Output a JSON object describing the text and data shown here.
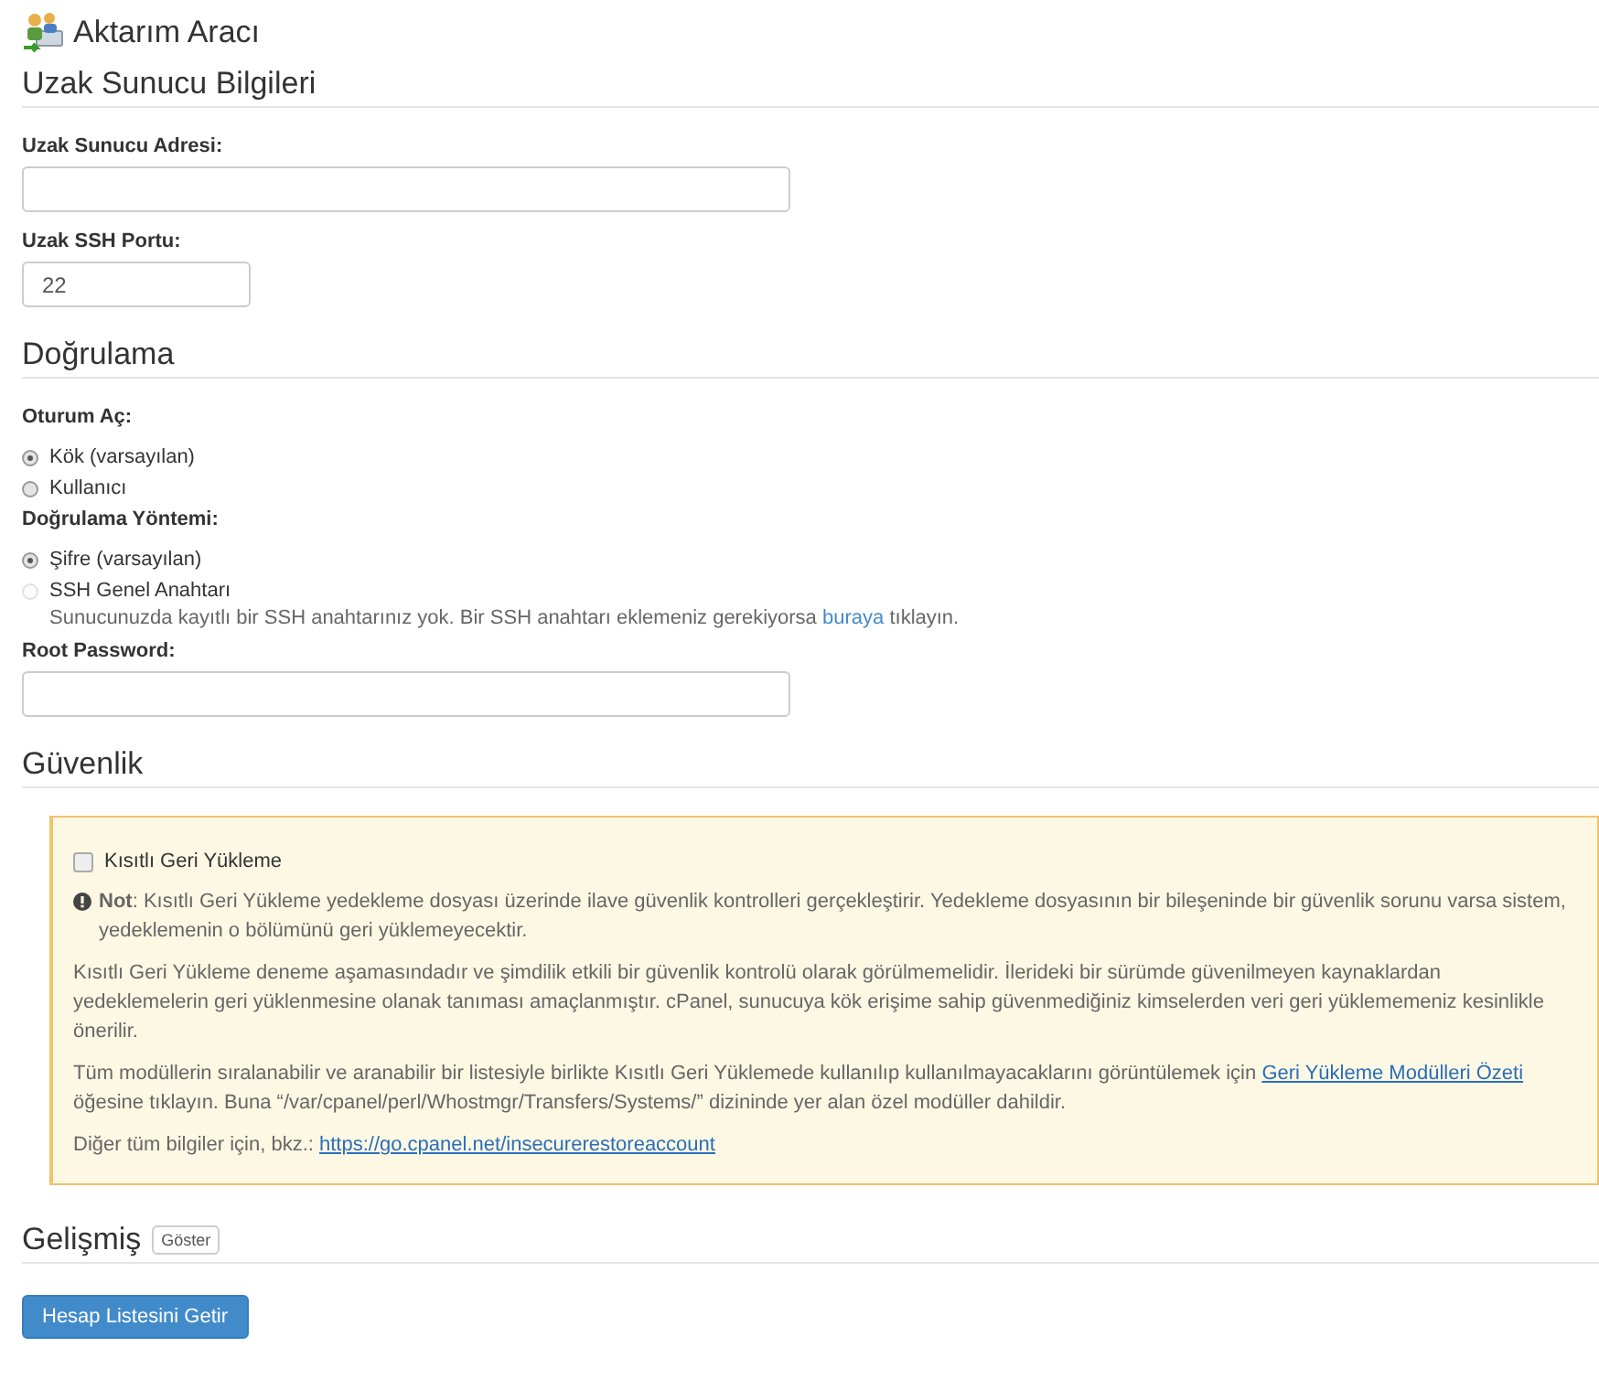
{
  "page": {
    "title": "Aktarım Aracı"
  },
  "remote_server": {
    "title": "Uzak Sunucu Bilgileri",
    "fields": [
      {
        "label": "Uzak Sunucu Adresi:"
      },
      {
        "label": "Uzak SSH Portu:",
        "value": "22"
      }
    ]
  },
  "authentication": {
    "title": "Doğrulama",
    "groups": [
      {
        "label": "Oturum Aç:",
        "options": [
          {
            "label": "Kök (varsayılan)",
            "selected": true,
            "disabled": false
          },
          {
            "label": "Kullanıcı",
            "selected": false,
            "disabled": false
          }
        ]
      },
      {
        "label": "Doğrulama Yöntemi:",
        "options": [
          {
            "label": "Şifre (varsayılan)",
            "selected": true,
            "disabled": false
          },
          {
            "label": "SSH Genel Anahtarı",
            "selected": false,
            "disabled": true
          }
        ]
      }
    ],
    "hint": {
      "before": "Sunucunuzda kayıtlı bir SSH anahtarınız yok. Bir SSH anahtarı eklemeniz gerekiyorsa",
      "link": "buraya",
      "after": "tıklayın."
    },
    "password": {
      "label": "Root Password:"
    }
  },
  "security": {
    "title": "Güvenlik",
    "checkbox": {
      "label": "Kısıtlı Geri Yükleme",
      "checked": false
    },
    "paragraphs": [
      {
        "kind": "note",
        "text": "**Not**: Kısıtlı Geri Yükleme yedekleme dosyası üzerinde ilave güvenlik kontrolleri gerçekleştirir. Yedekleme dosyasının bir bileşeninde bir güvenlik sorunu varsa sistem, yedeklemenin o bölümünü geri yüklemeyecektir."
      },
      {
        "kind": "plain",
        "text": "Kısıtlı Geri Yükleme deneme aşamasındadır ve şimdilik etkili bir güvenlik kontrolü olarak görülmemelidir. İlerideki bir sürümde güvenilmeyen kaynaklardan yedeklemelerin geri yüklenmesine olanak tanıması amaçlanmıştır. cPanel, sunucuya kök erişime sahip güvenmediğiniz kimselerden veri geri yüklememeniz kesinlikle önerilir."
      },
      {
        "kind": "link",
        "before": "Tüm modüllerin sıralanabilir ve aranabilir bir listesiyle birlikte Kısıtlı Geri Yüklemede kullanılıp kullanılmayacaklarını görüntülemek için",
        "link": "Geri Yükleme Modülleri Özeti",
        "after": "öğesine tıklayın. Buna “/var/cpanel/perl/Whostmgr/Transfers/Systems/” dizininde yer alan özel modüller dahildir."
      },
      {
        "kind": "link",
        "before": "Diğer tüm bilgiler için, bkz.:",
        "link": "https://go.cpanel.net/insecurerestoreaccount"
      }
    ]
  },
  "advanced": {
    "title": "Gelişmiş",
    "toggle": "Göster"
  },
  "submit": "Hesap Listesini Getir"
}
